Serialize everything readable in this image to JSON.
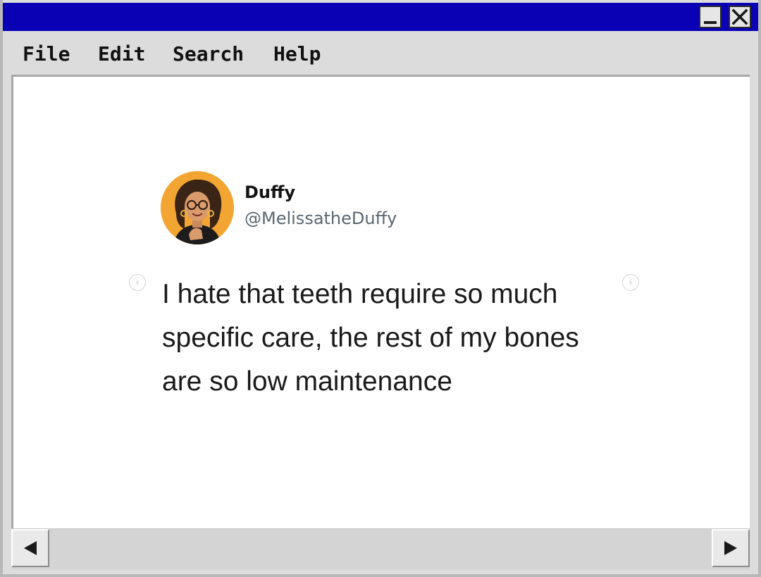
{
  "window": {
    "title_bar_color": "#0a00b4",
    "controls": {
      "minimize_icon": "minimize-icon",
      "close_icon": "close-icon"
    }
  },
  "menu": {
    "items": [
      {
        "label": "File"
      },
      {
        "label": "Edit"
      },
      {
        "label": "Search"
      },
      {
        "label": "Help"
      }
    ]
  },
  "tweet": {
    "display_name": "Duffy",
    "handle": "@MelissatheDuffy",
    "text": "I hate that teeth require so much\nspecific care, the rest of my bones\nare so low maintenance",
    "avatar_bg": "#f2a532"
  },
  "carousel": {
    "prev_glyph": "‹",
    "next_glyph": "›"
  },
  "scrollbar": {
    "left_icon": "arrow-left-icon",
    "right_icon": "arrow-right-icon"
  }
}
